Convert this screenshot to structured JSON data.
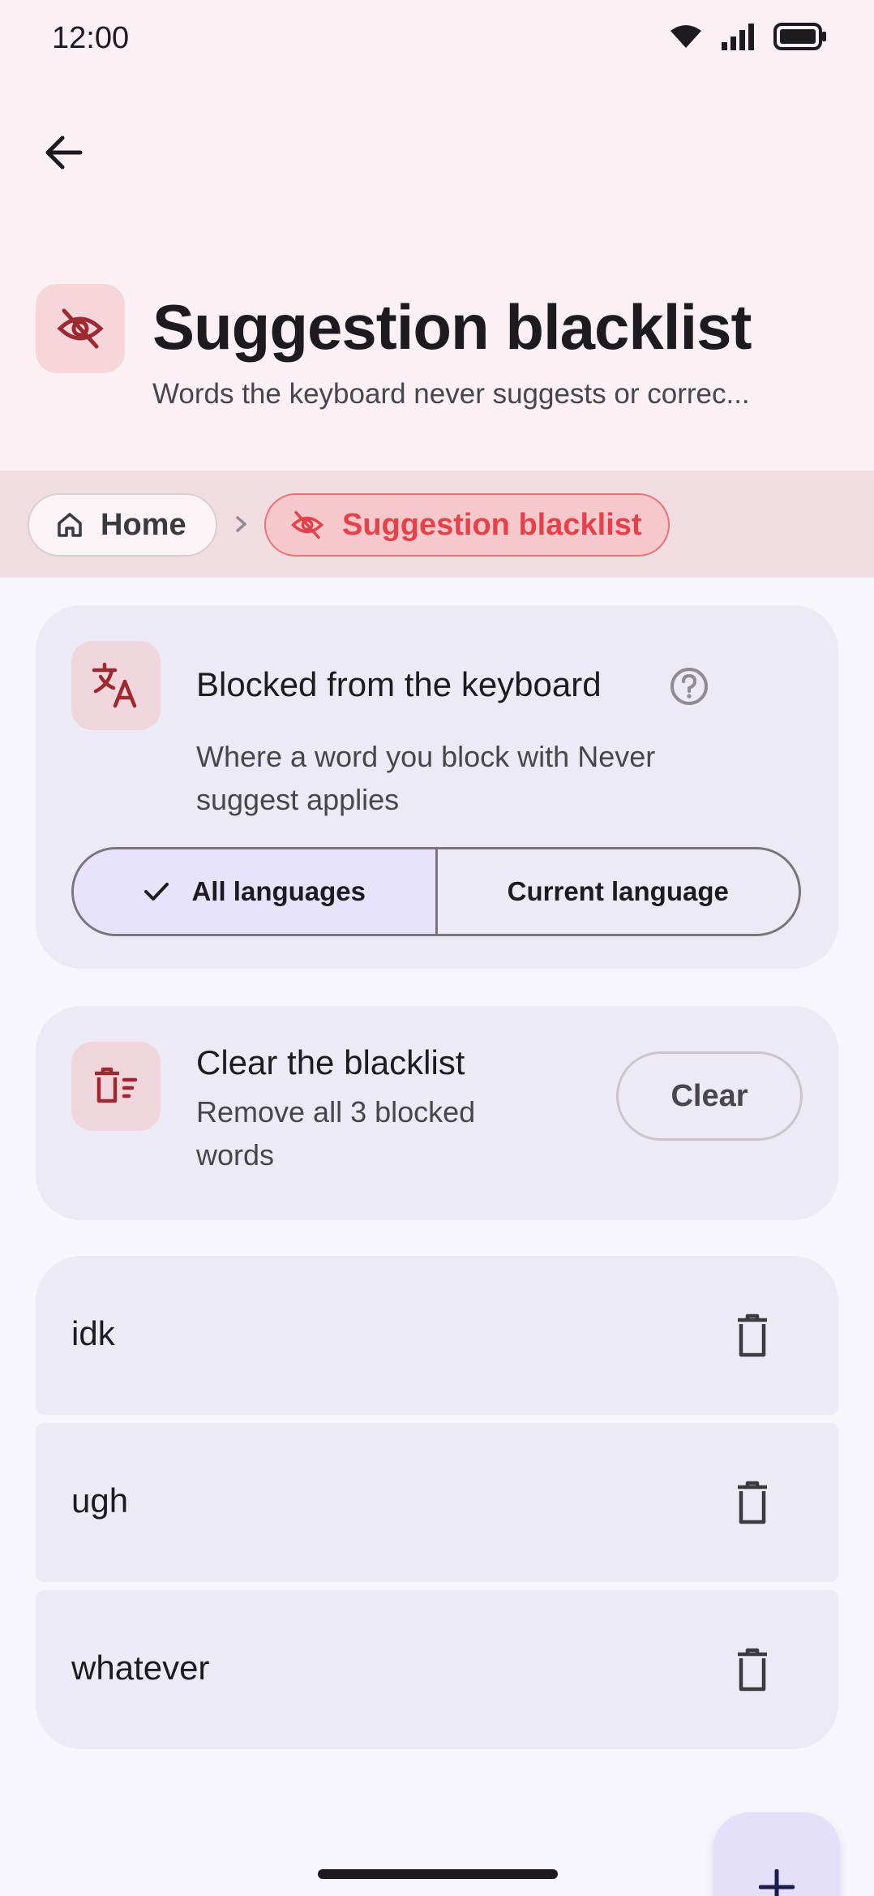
{
  "status_bar": {
    "time": "12:00"
  },
  "header": {
    "title": "Suggestion blacklist",
    "subtitle": "Words the keyboard never suggests or correc..."
  },
  "breadcrumb": {
    "home": "Home",
    "current": "Suggestion blacklist"
  },
  "scope_card": {
    "title": "Blocked from the keyboard",
    "description": "Where a word you block with Never suggest applies",
    "options": [
      {
        "label": "All languages",
        "selected": true
      },
      {
        "label": "Current language",
        "selected": false
      }
    ]
  },
  "clear_card": {
    "title": "Clear the blacklist",
    "description": "Remove all 3 blocked words",
    "button": "Clear"
  },
  "words": [
    "idk",
    "ugh",
    "whatever"
  ],
  "colors": {
    "accent": "#e2434b",
    "accent_container": "#f6c7cb",
    "surface": "#ecebf5",
    "selected_segment": "#e7e2fd",
    "icon_dark_red": "#9b2a33"
  },
  "icons": {
    "back": "arrow-left-icon",
    "title": "eye-off-icon",
    "home": "home-icon",
    "scope": "translate-icon",
    "help": "help-circle-icon",
    "clear": "delete-sweep-icon",
    "delete": "trash-icon",
    "fab": "plus-icon"
  }
}
